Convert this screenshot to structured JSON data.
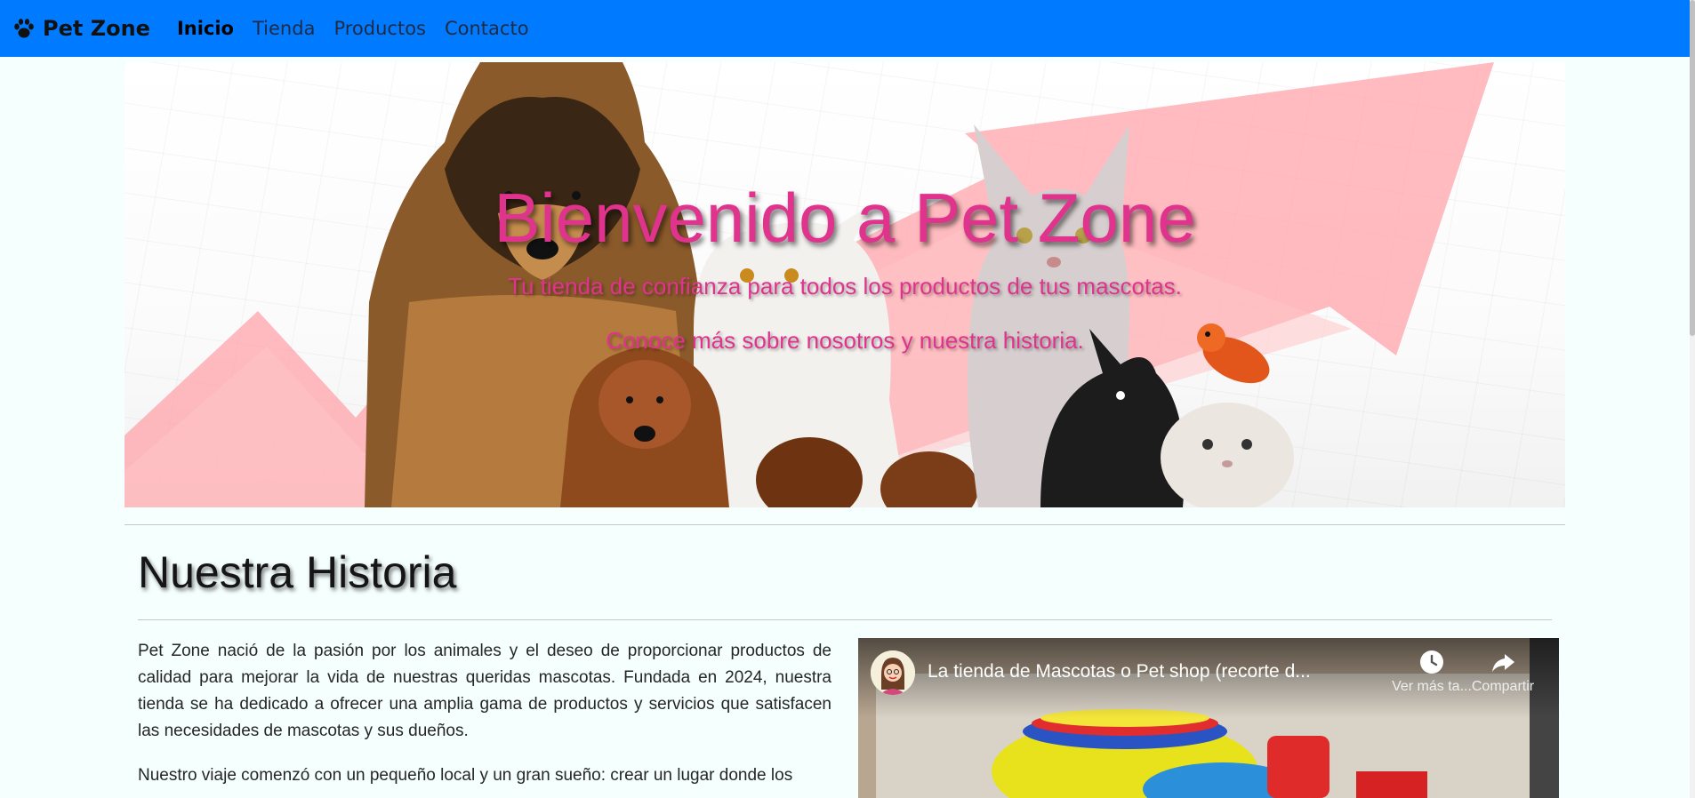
{
  "navbar": {
    "brand": "Pet Zone",
    "brand_icon": "paw-icon",
    "links": [
      "Inicio",
      "Tienda",
      "Productos",
      "Contacto"
    ],
    "active": "Inicio",
    "color": "#007bff"
  },
  "hero": {
    "title": "Bienvenido a Pet Zone",
    "subtitle": "Tu tienda de confianza para todos los productos de tus mascotas.",
    "tagline": "Conoce más sobre nosotros y nuestra historia.",
    "text_color": "#e0338d"
  },
  "section": {
    "title": "Nuestra Historia",
    "paragraph1": "Pet Zone nació de la pasión por los animales y el deseo de proporcionar productos de calidad para mejorar la vida de nuestras queridas mascotas. Fundada en 2024, nuestra tienda se ha dedicado a ofrecer una amplia gama de productos y servicios que satisfacen las necesidades de mascotas y sus dueños.",
    "paragraph2": "Nuestro viaje comenzó con un pequeño local y un gran sueño: crear un lugar donde los"
  },
  "video": {
    "title": "La tienda de Mascotas o Pet shop (recorte d...",
    "watch_later": "Ver más ta...",
    "share": "Compartir"
  }
}
